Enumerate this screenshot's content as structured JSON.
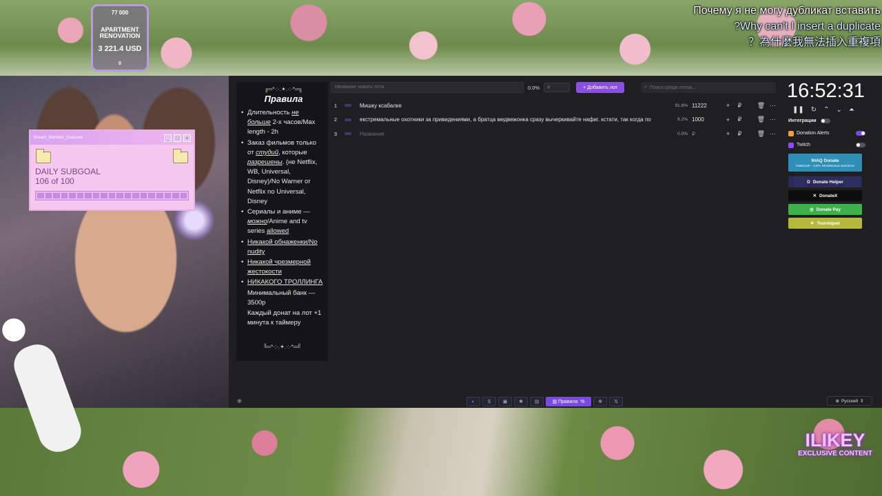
{
  "overlay": {
    "apartment": {
      "top": "77 000",
      "name": "APARTMENT RENOVATION",
      "value": "3 221.4 USD",
      "bottom": "0"
    },
    "captions": [
      "Почему я не могу дубликат вставить",
      "?Why can't I insert a duplicate",
      "？為什麼我無法插入重複項"
    ],
    "subgoal": {
      "window_title": "Stream_Member_Goal.exe",
      "title": "DAILY SUBGOAL",
      "progress_text": "106 of 100",
      "progress_value": 1.06
    },
    "watermark": {
      "big": "ILIKEY",
      "small": "EXCLUSIVE CONTENT"
    }
  },
  "rules": {
    "decor_top": "╔═*·:·.✦.·:·*═╗",
    "title": "Правила",
    "items": [
      {
        "pre": "Длительность ",
        "em": "не больше",
        "post": " 2-х часов/Max length - 2h"
      },
      {
        "pre": "Заказ фильмов только от ",
        "em": "студий",
        "mid": ", которые ",
        "em2": "разрешены",
        "post": ". (не Netflix, WB, Universal, Disney)/No Warner or Netflix no Universal, Disney"
      },
      {
        "pre": "Сериалы и аниме — ",
        "em": "можно",
        "post": "/Anime and tv series ",
        "u": "allowed"
      }
    ],
    "underlined": [
      "Никакой обнаженки/No nudity",
      "Никакой чрезмерной жестокости",
      "НИКАКОГО ТРОЛЛИНГА"
    ],
    "plain": [
      "Минимальный банк — 3500р",
      "Каждый донат на лот +1 минута к таймеру"
    ],
    "decor_bottom": "╚═*·:·.✦.·:·*═╝"
  },
  "topbar": {
    "lot_placeholder": "Название нового лота",
    "percent": "0.0%",
    "amount_placeholder": "₽",
    "add_button": "Добавить лот",
    "search_placeholder": "Поиск среди лотов..."
  },
  "lots": [
    {
      "num": "1",
      "name": "Мишку ксабалке",
      "percent": "91.8%",
      "amount": "11222",
      "currency": "₽",
      "placeholder": false
    },
    {
      "num": "2",
      "name": "екстремальные охотники за привидениями, а братца медвежонка сразу вычеркивайте нафиг. кстати, так когда по",
      "percent": "8.2%",
      "amount": "1000",
      "currency": "₽",
      "placeholder": false
    },
    {
      "num": "3",
      "name": "Название",
      "percent": "0.0%",
      "amount": "₽",
      "currency": "₽",
      "placeholder": true
    }
  ],
  "timer": "16:52:31",
  "integrations": {
    "title": "Интеграции",
    "items": [
      {
        "name": "Donation Alerts",
        "on": true
      },
      {
        "name": "Twitch",
        "on": false
      }
    ],
    "services": {
      "ihaq": "IHAQ Donate",
      "ihaq_sub": "Комиссия – 3,5%. Мгновенные выплаты!",
      "donate_helper": "Donate Helper",
      "donatex": "DonateX",
      "donate_pay": "Donate Pay",
      "tourniquet": "Tourniquet"
    }
  },
  "bottombar": {
    "active_tab": "Правила"
  },
  "language": "Русский",
  "colors": {
    "accent": "#8a4fe0",
    "panel": "#1f1f21",
    "rules_bg": "#151517"
  }
}
